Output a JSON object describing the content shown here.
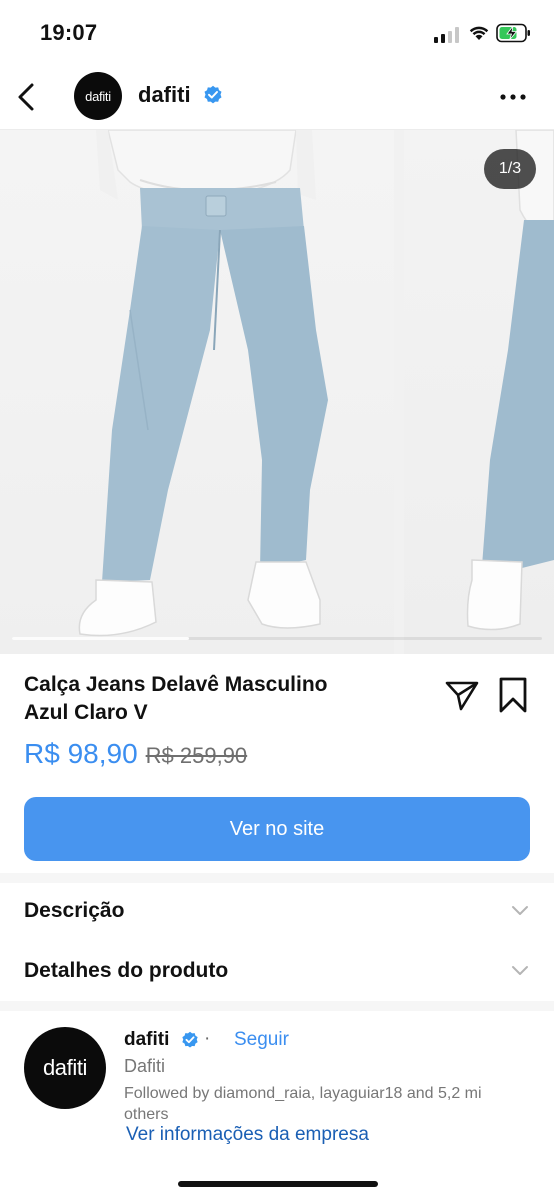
{
  "status_bar": {
    "time": "19:07",
    "icons": [
      "signal-icon",
      "wifi-icon",
      "battery-charging-icon"
    ]
  },
  "header": {
    "avatar_text": "dafiti",
    "username": "dafiti",
    "verified": true,
    "icons": [
      "back-arrow-icon",
      "verified-badge-icon",
      "more-options-icon"
    ]
  },
  "carousel": {
    "page_indicator": "1/3",
    "current_page": 1,
    "total_pages": 3
  },
  "product": {
    "title_line1": "Calça Jeans Delavê Masculino",
    "title_line2": "Azul Claro V",
    "price": "R$ 98,90",
    "old_price": "R$ 259,90",
    "cta_label": "Ver no site",
    "icons": [
      "share-icon",
      "bookmark-icon"
    ]
  },
  "sections": [
    {
      "label": "Descrição"
    },
    {
      "label": "Detalhes do produto"
    }
  ],
  "seller": {
    "avatar_text": "dafiti",
    "username": "dafiti",
    "separator": "·",
    "follow_label": "Seguir",
    "full_name": "Dafiti",
    "followed_by": "Followed by diamond_raia, layaguiar18 and 5,2 mi others",
    "company_link": "Ver informações da empresa"
  },
  "colors": {
    "accent": "#3b8ef0",
    "button": "#4895ef",
    "verified": "#3897f0",
    "link_dark": "#1a5fb4"
  }
}
